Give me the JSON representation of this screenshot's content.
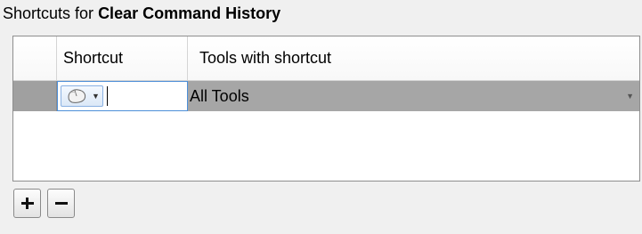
{
  "title": {
    "prefix": "Shortcuts for",
    "command": "Clear Command History"
  },
  "table": {
    "columns": [
      "Shortcut",
      "Tools with shortcut"
    ],
    "rows": [
      {
        "shortcut_value": "",
        "input_kind_icon": "mouse-icon",
        "tools": "All Tools",
        "selected": true
      }
    ]
  },
  "buttons": {
    "add_icon": "plus-icon",
    "remove_icon": "minus-icon"
  },
  "colors": {
    "selected_row": "#a6a6a6",
    "focus_border": "#4d8fd8"
  }
}
